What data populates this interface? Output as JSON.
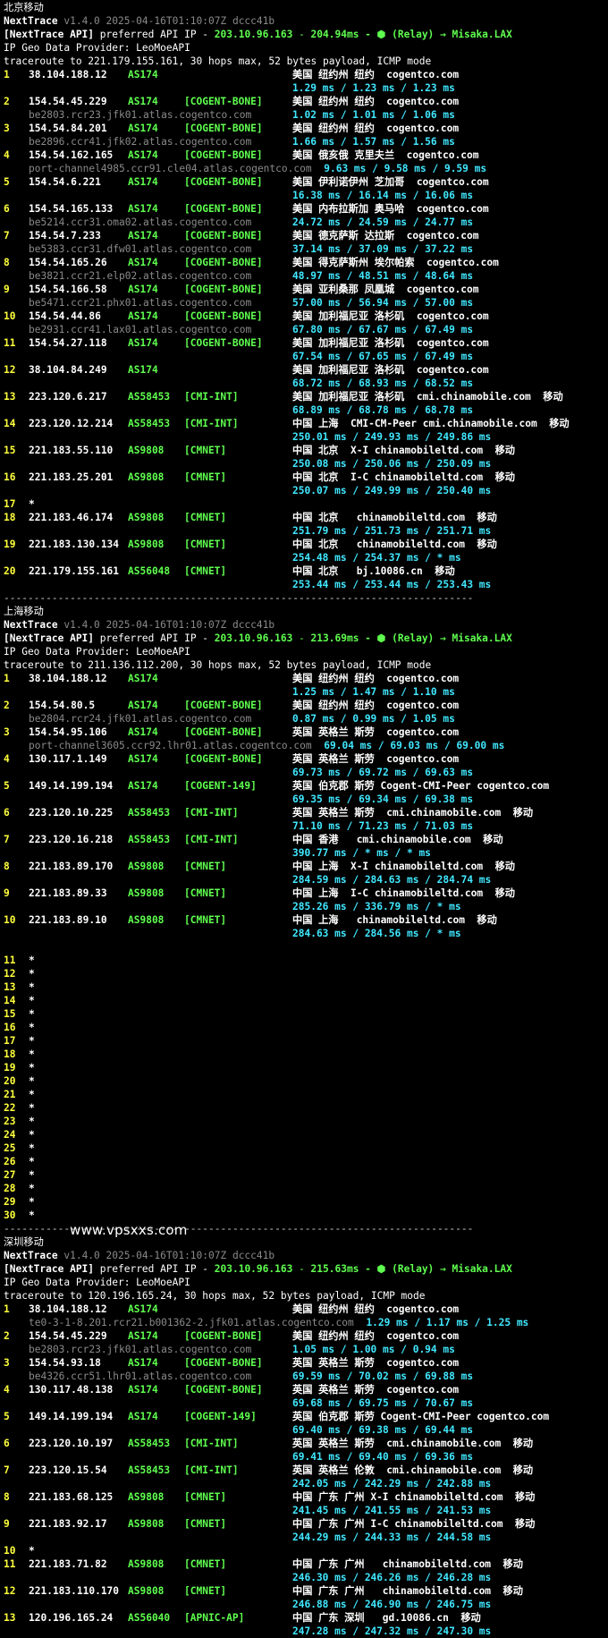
{
  "app": "NextTrace",
  "watermark": "www.vpsxxs.com",
  "sections": [
    {
      "title": "北京移动",
      "version": "v1.4.0 2025-04-16T01:10:07Z dccc41b",
      "api": {
        "prefix": "[NextTrace API]",
        "mid": " preferred API IP - ",
        "ip": "203.10.96.163",
        "dash": " - ",
        "ms": "204.94ms",
        "relay": " - ⬢ (Relay) → Misaka.LAX"
      },
      "geo_provider": "IP Geo Data Provider: LeoMoeAPI",
      "traceroute": "traceroute to 221.179.155.161, 30 hops max, 52 bytes payload, ICMP mode",
      "hops": [
        {
          "hop": "1",
          "ip": "38.104.188.12",
          "as": "AS174",
          "net": "",
          "geo": "美国 纽约州 纽约  cogentco.com",
          "rdns": "",
          "rtt": "1.29 ms / 1.23 ms / 1.23 ms",
          "rtt_inline": false
        },
        {
          "hop": "2",
          "ip": "154.54.45.229",
          "as": "AS174",
          "net": "[COGENT-BONE]",
          "geo": "美国 纽约州 纽约  cogentco.com",
          "rdns": "be2803.rcr23.jfk01.atlas.cogentco.com",
          "rtt": "1.02 ms / 1.01 ms / 1.06 ms",
          "rtt_inline": false
        },
        {
          "hop": "3",
          "ip": "154.54.84.201",
          "as": "AS174",
          "net": "[COGENT-BONE]",
          "geo": "美国 纽约州 纽约  cogentco.com",
          "rdns": "be2896.ccr41.jfk02.atlas.cogentco.com",
          "rtt": "1.66 ms / 1.57 ms / 1.56 ms",
          "rtt_inline": false
        },
        {
          "hop": "4",
          "ip": "154.54.162.165",
          "as": "AS174",
          "net": "[COGENT-BONE]",
          "geo": "美国 俄亥俄 克里夫兰  cogentco.com",
          "rdns": "port-channel4985.ccr91.cle04.atlas.cogentco.com",
          "rtt": "9.63 ms / 9.58 ms / 9.59 ms",
          "rtt_inline": true
        },
        {
          "hop": "5",
          "ip": "154.54.6.221",
          "as": "AS174",
          "net": "[COGENT-BONE]",
          "geo": "美国 伊利诺伊州 芝加哥  cogentco.com",
          "rdns": "",
          "rtt": "16.38 ms / 16.14 ms / 16.06 ms",
          "rtt_inline": false
        },
        {
          "hop": "6",
          "ip": "154.54.165.133",
          "as": "AS174",
          "net": "[COGENT-BONE]",
          "geo": "美国 内布拉斯加 奥马哈  cogentco.com",
          "rdns": "be5214.ccr31.oma02.atlas.cogentco.com",
          "rtt": "24.72 ms / 24.59 ms / 24.77 ms",
          "rtt_inline": false
        },
        {
          "hop": "7",
          "ip": "154.54.7.233",
          "as": "AS174",
          "net": "[COGENT-BONE]",
          "geo": "美国 德克萨斯 达拉斯  cogentco.com",
          "rdns": "be5383.ccr31.dfw01.atlas.cogentco.com",
          "rtt": "37.14 ms / 37.09 ms / 37.22 ms",
          "rtt_inline": false
        },
        {
          "hop": "8",
          "ip": "154.54.165.26",
          "as": "AS174",
          "net": "[COGENT-BONE]",
          "geo": "美国 得克萨斯州 埃尔帕索  cogentco.com",
          "rdns": "be3821.ccr21.elp02.atlas.cogentco.com",
          "rtt": "48.97 ms / 48.51 ms / 48.64 ms",
          "rtt_inline": false
        },
        {
          "hop": "9",
          "ip": "154.54.166.58",
          "as": "AS174",
          "net": "[COGENT-BONE]",
          "geo": "美国 亚利桑那 凤凰城  cogentco.com",
          "rdns": "be5471.ccr21.phx01.atlas.cogentco.com",
          "rtt": "57.00 ms / 56.94 ms / 57.00 ms",
          "rtt_inline": false
        },
        {
          "hop": "10",
          "ip": "154.54.44.86",
          "as": "AS174",
          "net": "[COGENT-BONE]",
          "geo": "美国 加利福尼亚 洛杉矶  cogentco.com",
          "rdns": "be2931.ccr41.lax01.atlas.cogentco.com",
          "rtt": "67.80 ms / 67.67 ms / 67.49 ms",
          "rtt_inline": false
        },
        {
          "hop": "11",
          "ip": "154.54.27.118",
          "as": "AS174",
          "net": "[COGENT-BONE]",
          "geo": "美国 加利福尼亚 洛杉矶  cogentco.com",
          "rdns": "",
          "rtt": "67.54 ms / 67.65 ms / 67.49 ms",
          "rtt_inline": false
        },
        {
          "hop": "12",
          "ip": "38.104.84.249",
          "as": "AS174",
          "net": "",
          "geo": "美国 加利福尼亚 洛杉矶  cogentco.com",
          "rdns": "",
          "rtt": "68.72 ms / 68.93 ms / 68.52 ms",
          "rtt_inline": false
        },
        {
          "hop": "13",
          "ip": "223.120.6.217",
          "as": "AS58453",
          "net": "[CMI-INT]",
          "geo": "美国 加利福尼亚 洛杉矶  cmi.chinamobile.com  移动",
          "rdns": "",
          "rtt": "68.89 ms / 68.78 ms / 68.78 ms",
          "rtt_inline": false
        },
        {
          "hop": "14",
          "ip": "223.120.12.214",
          "as": "AS58453",
          "net": "[CMI-INT]",
          "geo": "中国 上海  CMI-CM-Peer cmi.chinamobile.com  移动",
          "rdns": "",
          "rtt": "250.01 ms / 249.93 ms / 249.86 ms",
          "rtt_inline": false
        },
        {
          "hop": "15",
          "ip": "221.183.55.110",
          "as": "AS9808",
          "net": "[CMNET]",
          "geo": "中国 北京  X-I chinamobileltd.com  移动",
          "rdns": "",
          "rtt": "250.08 ms / 250.06 ms / 250.09 ms",
          "rtt_inline": false
        },
        {
          "hop": "16",
          "ip": "221.183.25.201",
          "as": "AS9808",
          "net": "[CMNET]",
          "geo": "中国 北京  I-C chinamobileltd.com  移动",
          "rdns": "",
          "rtt": "250.07 ms / 249.99 ms / 250.40 ms",
          "rtt_inline": false
        },
        {
          "hop": "17",
          "ip": "*",
          "as": "",
          "net": "",
          "geo": "",
          "rdns": "",
          "rtt": "",
          "rtt_inline": false
        },
        {
          "hop": "18",
          "ip": "221.183.46.174",
          "as": "AS9808",
          "net": "[CMNET]",
          "geo": "中国 北京   chinamobileltd.com  移动",
          "rdns": "",
          "rtt": "251.79 ms / 251.73 ms / 251.71 ms",
          "rtt_inline": false
        },
        {
          "hop": "19",
          "ip": "221.183.130.134",
          "as": "AS9808",
          "net": "[CMNET]",
          "geo": "中国 北京   chinamobileltd.com  移动",
          "rdns": "",
          "rtt": "254.48 ms / 254.37 ms / * ms",
          "rtt_inline": false
        },
        {
          "hop": "20",
          "ip": "221.179.155.161",
          "as": "AS56048",
          "net": "[CMNET]",
          "geo": "中国 北京   bj.10086.cn  移动",
          "rdns": "",
          "rtt": "253.44 ms / 253.44 ms / 253.43 ms",
          "rtt_inline": false
        }
      ]
    },
    {
      "title": "上海移动",
      "version": "v1.4.0 2025-04-16T01:10:07Z dccc41b",
      "api": {
        "prefix": "[NextTrace API]",
        "mid": " preferred API IP - ",
        "ip": "203.10.96.163",
        "dash": " - ",
        "ms": "213.69ms",
        "relay": " - ⬢ (Relay) → Misaka.LAX"
      },
      "geo_provider": "IP Geo Data Provider: LeoMoeAPI",
      "traceroute": "traceroute to 211.136.112.200, 30 hops max, 52 bytes payload, ICMP mode",
      "hops": [
        {
          "hop": "1",
          "ip": "38.104.188.12",
          "as": "AS174",
          "net": "",
          "geo": "美国 纽约州 纽约  cogentco.com",
          "rdns": "",
          "rtt": "1.25 ms / 1.47 ms / 1.10 ms",
          "rtt_inline": false
        },
        {
          "hop": "2",
          "ip": "154.54.80.5",
          "as": "AS174",
          "net": "[COGENT-BONE]",
          "geo": "美国 纽约州 纽约  cogentco.com",
          "rdns": "be2804.rcr24.jfk01.atlas.cogentco.com",
          "rtt": "0.87 ms / 0.99 ms / 1.05 ms",
          "rtt_inline": false
        },
        {
          "hop": "3",
          "ip": "154.54.95.106",
          "as": "AS174",
          "net": "[COGENT-BONE]",
          "geo": "英国 英格兰 斯劳  cogentco.com",
          "rdns": "port-channel3605.ccr92.lhr01.atlas.cogentco.com",
          "rtt": "69.04 ms / 69.03 ms / 69.00 ms",
          "rtt_inline": true
        },
        {
          "hop": "4",
          "ip": "130.117.1.149",
          "as": "AS174",
          "net": "[COGENT-BONE]",
          "geo": "英国 英格兰 斯劳  cogentco.com",
          "rdns": "",
          "rtt": "69.73 ms / 69.72 ms / 69.63 ms",
          "rtt_inline": false
        },
        {
          "hop": "5",
          "ip": "149.14.199.194",
          "as": "AS174",
          "net": "[COGENT-149]",
          "geo": "英国 伯克郡 斯劳 Cogent-CMI-Peer cogentco.com",
          "rdns": "",
          "rtt": "69.35 ms / 69.34 ms / 69.38 ms",
          "rtt_inline": false
        },
        {
          "hop": "6",
          "ip": "223.120.10.225",
          "as": "AS58453",
          "net": "[CMI-INT]",
          "geo": "英国 英格兰 斯劳  cmi.chinamobile.com  移动",
          "rdns": "",
          "rtt": "71.10 ms / 71.23 ms / 71.03 ms",
          "rtt_inline": false
        },
        {
          "hop": "7",
          "ip": "223.120.16.218",
          "as": "AS58453",
          "net": "[CMI-INT]",
          "geo": "中国 香港   cmi.chinamobile.com  移动",
          "rdns": "",
          "rtt": "390.77 ms / * ms / * ms",
          "rtt_inline": false
        },
        {
          "hop": "8",
          "ip": "221.183.89.170",
          "as": "AS9808",
          "net": "[CMNET]",
          "geo": "中国 上海  X-I chinamobileltd.com  移动",
          "rdns": "",
          "rtt": "284.59 ms / 284.63 ms / 284.74 ms",
          "rtt_inline": false
        },
        {
          "hop": "9",
          "ip": "221.183.89.33",
          "as": "AS9808",
          "net": "[CMNET]",
          "geo": "中国 上海  I-C chinamobileltd.com  移动",
          "rdns": "",
          "rtt": "285.26 ms / 336.79 ms / * ms",
          "rtt_inline": false
        },
        {
          "hop": "10",
          "ip": "221.183.89.10",
          "as": "AS9808",
          "net": "[CMNET]",
          "geo": "中国 上海   chinamobileltd.com  移动",
          "rdns": "",
          "rtt": "284.63 ms / 284.56 ms / * ms",
          "rtt_inline": false
        },
        {
          "hop": "11",
          "ip": "*",
          "as": "",
          "net": "",
          "geo": "",
          "rdns": "",
          "rtt": "",
          "rtt_inline": false,
          "gap_before": true
        },
        {
          "hop": "12",
          "ip": "*",
          "as": "",
          "net": "",
          "geo": "",
          "rdns": "",
          "rtt": "",
          "rtt_inline": false
        },
        {
          "hop": "13",
          "ip": "*",
          "as": "",
          "net": "",
          "geo": "",
          "rdns": "",
          "rtt": "",
          "rtt_inline": false
        },
        {
          "hop": "14",
          "ip": "*",
          "as": "",
          "net": "",
          "geo": "",
          "rdns": "",
          "rtt": "",
          "rtt_inline": false
        },
        {
          "hop": "15",
          "ip": "*",
          "as": "",
          "net": "",
          "geo": "",
          "rdns": "",
          "rtt": "",
          "rtt_inline": false
        },
        {
          "hop": "16",
          "ip": "*",
          "as": "",
          "net": "",
          "geo": "",
          "rdns": "",
          "rtt": "",
          "rtt_inline": false
        },
        {
          "hop": "17",
          "ip": "*",
          "as": "",
          "net": "",
          "geo": "",
          "rdns": "",
          "rtt": "",
          "rtt_inline": false
        },
        {
          "hop": "18",
          "ip": "*",
          "as": "",
          "net": "",
          "geo": "",
          "rdns": "",
          "rtt": "",
          "rtt_inline": false
        },
        {
          "hop": "19",
          "ip": "*",
          "as": "",
          "net": "",
          "geo": "",
          "rdns": "",
          "rtt": "",
          "rtt_inline": false
        },
        {
          "hop": "20",
          "ip": "*",
          "as": "",
          "net": "",
          "geo": "",
          "rdns": "",
          "rtt": "",
          "rtt_inline": false
        },
        {
          "hop": "21",
          "ip": "*",
          "as": "",
          "net": "",
          "geo": "",
          "rdns": "",
          "rtt": "",
          "rtt_inline": false
        },
        {
          "hop": "22",
          "ip": "*",
          "as": "",
          "net": "",
          "geo": "",
          "rdns": "",
          "rtt": "",
          "rtt_inline": false
        },
        {
          "hop": "23",
          "ip": "*",
          "as": "",
          "net": "",
          "geo": "",
          "rdns": "",
          "rtt": "",
          "rtt_inline": false
        },
        {
          "hop": "24",
          "ip": "*",
          "as": "",
          "net": "",
          "geo": "",
          "rdns": "",
          "rtt": "",
          "rtt_inline": false
        },
        {
          "hop": "25",
          "ip": "*",
          "as": "",
          "net": "",
          "geo": "",
          "rdns": "",
          "rtt": "",
          "rtt_inline": false
        },
        {
          "hop": "26",
          "ip": "*",
          "as": "",
          "net": "",
          "geo": "",
          "rdns": "",
          "rtt": "",
          "rtt_inline": false
        },
        {
          "hop": "27",
          "ip": "*",
          "as": "",
          "net": "",
          "geo": "",
          "rdns": "",
          "rtt": "",
          "rtt_inline": false
        },
        {
          "hop": "28",
          "ip": "*",
          "as": "",
          "net": "",
          "geo": "",
          "rdns": "",
          "rtt": "",
          "rtt_inline": false
        },
        {
          "hop": "29",
          "ip": "*",
          "as": "",
          "net": "",
          "geo": "",
          "rdns": "",
          "rtt": "",
          "rtt_inline": false
        },
        {
          "hop": "30",
          "ip": "*",
          "as": "",
          "net": "",
          "geo": "",
          "rdns": "",
          "rtt": "",
          "rtt_inline": false
        }
      ]
    },
    {
      "title": "深圳移动",
      "version": "v1.4.0 2025-04-16T01:10:07Z dccc41b",
      "api": {
        "prefix": "[NextTrace API]",
        "mid": " preferred API IP - ",
        "ip": "203.10.96.163",
        "dash": " - ",
        "ms": "215.63ms",
        "relay": " - ⬢ (Relay) → Misaka.LAX"
      },
      "geo_provider": "IP Geo Data Provider: LeoMoeAPI",
      "traceroute": "traceroute to 120.196.165.24, 30 hops max, 52 bytes payload, ICMP mode",
      "hops": [
        {
          "hop": "1",
          "ip": "38.104.188.12",
          "as": "AS174",
          "net": "",
          "geo": "美国 纽约州 纽约  cogentco.com",
          "rdns": "te0-3-1-8.201.rcr21.b001362-2.jfk01.atlas.cogentco.com",
          "rtt": "1.29 ms / 1.17 ms / 1.25 ms",
          "rtt_inline": true
        },
        {
          "hop": "2",
          "ip": "154.54.45.229",
          "as": "AS174",
          "net": "[COGENT-BONE]",
          "geo": "美国 纽约州 纽约  cogentco.com",
          "rdns": "be2803.rcr23.jfk01.atlas.cogentco.com",
          "rtt": "1.05 ms / 1.00 ms / 0.94 ms",
          "rtt_inline": false
        },
        {
          "hop": "3",
          "ip": "154.54.93.18",
          "as": "AS174",
          "net": "[COGENT-BONE]",
          "geo": "英国 英格兰 斯劳  cogentco.com",
          "rdns": "be4326.ccr51.lhr01.atlas.cogentco.com",
          "rtt": "69.59 ms / 70.02 ms / 69.88 ms",
          "rtt_inline": false
        },
        {
          "hop": "4",
          "ip": "130.117.48.138",
          "as": "AS174",
          "net": "[COGENT-BONE]",
          "geo": "英国 英格兰 斯劳  cogentco.com",
          "rdns": "",
          "rtt": "69.68 ms / 69.75 ms / 70.67 ms",
          "rtt_inline": false
        },
        {
          "hop": "5",
          "ip": "149.14.199.194",
          "as": "AS174",
          "net": "[COGENT-149]",
          "geo": "英国 伯克郡 斯劳 Cogent-CMI-Peer cogentco.com",
          "rdns": "",
          "rtt": "69.40 ms / 69.38 ms / 69.44 ms",
          "rtt_inline": false
        },
        {
          "hop": "6",
          "ip": "223.120.10.197",
          "as": "AS58453",
          "net": "[CMI-INT]",
          "geo": "英国 英格兰 斯劳  cmi.chinamobile.com  移动",
          "rdns": "",
          "rtt": "69.41 ms / 69.40 ms / 69.36 ms",
          "rtt_inline": false
        },
        {
          "hop": "7",
          "ip": "223.120.15.54",
          "as": "AS58453",
          "net": "[CMI-INT]",
          "geo": "英国 英格兰 伦敦  cmi.chinamobile.com  移动",
          "rdns": "",
          "rtt": "242.05 ms / 242.29 ms / 242.88 ms",
          "rtt_inline": false
        },
        {
          "hop": "8",
          "ip": "221.183.68.125",
          "as": "AS9808",
          "net": "[CMNET]",
          "geo": "中国 广东 广州 X-I chinamobileltd.com  移动",
          "rdns": "",
          "rtt": "241.45 ms / 241.55 ms / 241.53 ms",
          "rtt_inline": false
        },
        {
          "hop": "9",
          "ip": "221.183.92.17",
          "as": "AS9808",
          "net": "[CMNET]",
          "geo": "中国 广东 广州 I-C chinamobileltd.com  移动",
          "rdns": "",
          "rtt": "244.29 ms / 244.33 ms / 244.58 ms",
          "rtt_inline": false
        },
        {
          "hop": "10",
          "ip": "*",
          "as": "",
          "net": "",
          "geo": "",
          "rdns": "",
          "rtt": "",
          "rtt_inline": false
        },
        {
          "hop": "11",
          "ip": "221.183.71.82",
          "as": "AS9808",
          "net": "[CMNET]",
          "geo": "中国 广东 广州   chinamobileltd.com  移动",
          "rdns": "",
          "rtt": "246.30 ms / 246.26 ms / 246.28 ms",
          "rtt_inline": false
        },
        {
          "hop": "12",
          "ip": "221.183.110.170",
          "as": "AS9808",
          "net": "[CMNET]",
          "geo": "中国 广东 广州   chinamobileltd.com  移动",
          "rdns": "",
          "rtt": "246.88 ms / 246.90 ms / 246.75 ms",
          "rtt_inline": false
        },
        {
          "hop": "13",
          "ip": "120.196.165.24",
          "as": "AS56040",
          "net": "[APNIC-AP]",
          "geo": "中国 广东 深圳   gd.10086.cn  移动",
          "rdns": "",
          "rtt": "247.28 ms / 247.32 ms / 247.30 ms",
          "rtt_inline": false
        }
      ]
    }
  ],
  "separator": "------------------------------------------------------------------------------",
  "colors": {
    "background": "#000000",
    "hop_number": "#ffff3c",
    "as_net": "#5fff4f",
    "rtt": "#40e8ff",
    "dim": "#8a8a8a",
    "text": "#ffffff"
  }
}
